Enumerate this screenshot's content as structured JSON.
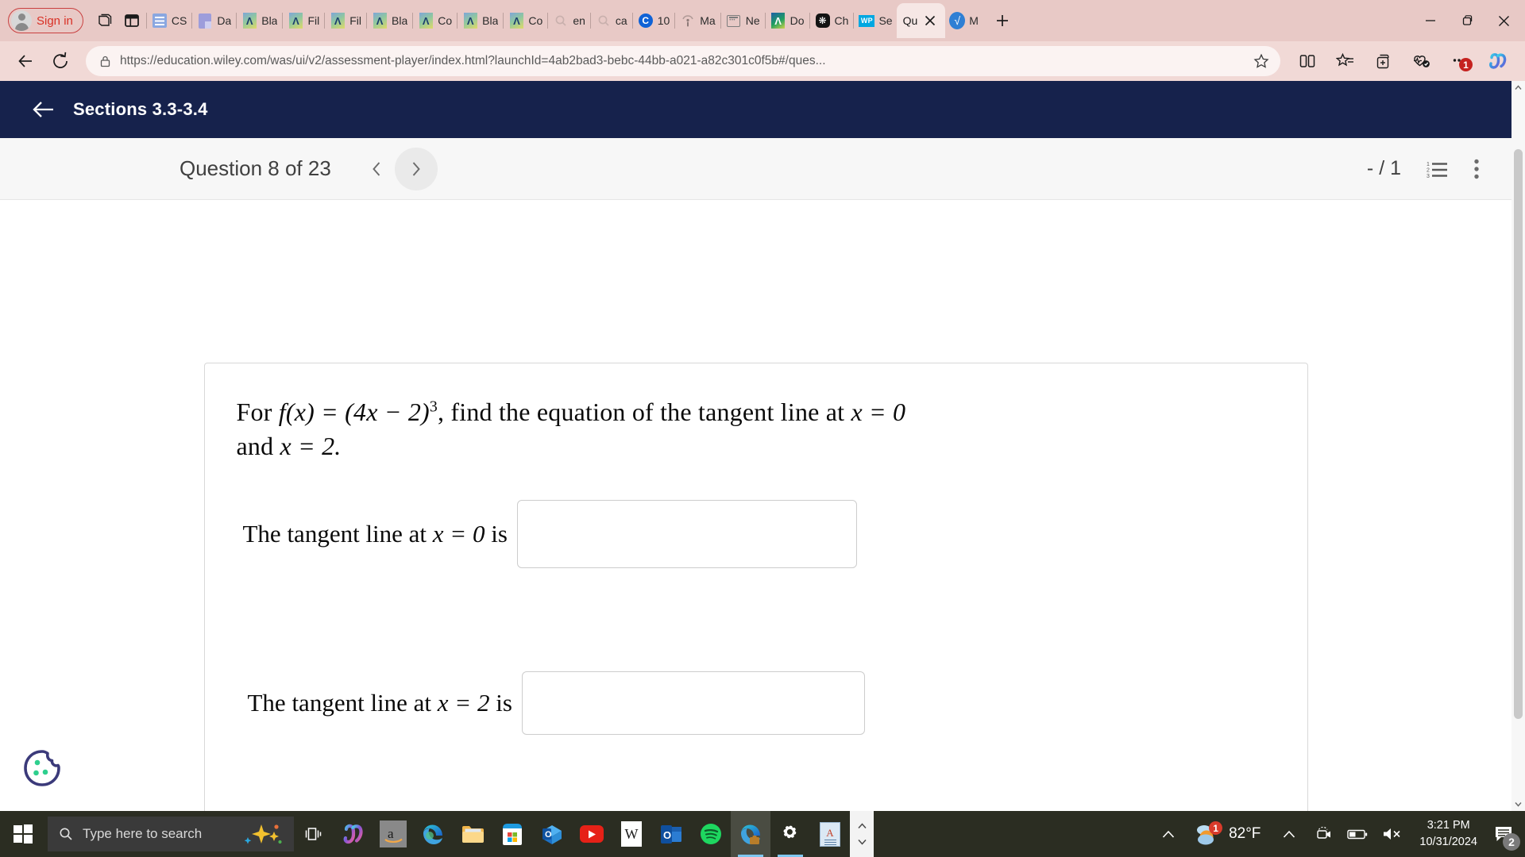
{
  "browser": {
    "signin_label": "Sign in",
    "tabs": [
      {
        "label": "CS",
        "icon": "csv-icon"
      },
      {
        "label": "Da",
        "icon": "document-purple-icon"
      },
      {
        "label": "Bla",
        "icon": "anaconda-icon"
      },
      {
        "label": "Fil",
        "icon": "anaconda-icon"
      },
      {
        "label": "Fil",
        "icon": "anaconda-icon"
      },
      {
        "label": "Bla",
        "icon": "anaconda-icon"
      },
      {
        "label": "Co",
        "icon": "anaconda-icon"
      },
      {
        "label": "Bla",
        "icon": "anaconda-icon"
      },
      {
        "label": "Co",
        "icon": "anaconda-icon"
      },
      {
        "label": "en",
        "icon": "search-icon"
      },
      {
        "label": "ca",
        "icon": "search-icon"
      },
      {
        "label": "10",
        "icon": "circle-c-icon"
      },
      {
        "label": "Ma",
        "icon": "info-icon"
      },
      {
        "label": "Ne",
        "icon": "news-icon"
      },
      {
        "label": "Do",
        "icon": "anaconda-dark-icon"
      },
      {
        "label": "Ch",
        "icon": "openai-icon"
      },
      {
        "label": "Se",
        "icon": "wp-icon"
      }
    ],
    "active_tab": {
      "label": "Qu",
      "icon": "sqrt-icon"
    },
    "trailing_tab": {
      "label": "M",
      "icon": "sqrt-icon"
    },
    "url_display": "https://education.wiley.com/was/ui/v2/assessment-player/index.html?launchId=4ab2bad3-bebc-44bb-a021-a82c301c0f5b#/ques...",
    "url_domain": "education.wiley.com",
    "url_scheme": "https://",
    "url_path": "/was/ui/v2/assessment-player/index.html?launchId=4ab2bad3-bebc-44bb-a021-a82c301c0f5b#/ques...",
    "toolbar_icons": [
      "back-icon",
      "reload-icon",
      "lock-icon",
      "favorite-star-icon",
      "split-screen-icon",
      "favorites-icon",
      "collections-icon",
      "browser-essentials-icon",
      "settings-more-icon",
      "copilot-icon"
    ],
    "settings_badge": "1"
  },
  "app": {
    "header": {
      "title": "Sections 3.3-3.4",
      "back_icon": "back-arrow-icon"
    },
    "question_bar": {
      "title": "Question 8 of 23",
      "prev_icon": "chevron-left-icon",
      "next_icon": "chevron-right-icon",
      "score": "- / 1",
      "list_icon": "numbered-list-icon",
      "menu_icon": "more-vertical-icon"
    },
    "question": {
      "stem_prefix": "For ",
      "stem_fn": "f(x) = (4x − 2)",
      "stem_exp": "3",
      "stem_mid": ", find the equation of the tangent line at ",
      "stem_x0": "x = 0",
      "stem_and": "and ",
      "stem_x2": "x = 2.",
      "answers": [
        {
          "label_pre": "The tangent line at ",
          "label_var": "x = 0",
          "label_post": " is",
          "value": "",
          "placeholder": ""
        },
        {
          "label_pre": "The tangent line at ",
          "label_var": "x = 2",
          "label_post": " is",
          "value": "",
          "placeholder": ""
        }
      ]
    },
    "cookie_icon": "cookie-consent-icon"
  },
  "taskbar": {
    "start_icon": "windows-start-icon",
    "search_placeholder": "Type here to search",
    "search_icon": "search-icon",
    "copilot_sparkle_icon": "sparkle-icon",
    "apps": [
      {
        "name": "task-view-icon"
      },
      {
        "name": "copilot-icon"
      },
      {
        "name": "amazon-icon"
      },
      {
        "name": "edge-icon"
      },
      {
        "name": "file-explorer-icon"
      },
      {
        "name": "microsoft-store-icon"
      },
      {
        "name": "outlook-new-icon"
      },
      {
        "name": "youtube-icon"
      },
      {
        "name": "wikipedia-icon"
      },
      {
        "name": "outlook-icon"
      },
      {
        "name": "spotify-icon"
      },
      {
        "name": "edge-work-icon"
      },
      {
        "name": "settings-gear-icon"
      },
      {
        "name": "document-icon"
      }
    ],
    "tray": {
      "show_hidden_icon": "chevron-up-icon",
      "weather_icon": "weather-rain-icon",
      "weather_badge": "1",
      "temperature": "82°F",
      "camera_icon": "camera-icon",
      "battery_icon": "battery-icon",
      "volume_icon": "volume-muted-icon",
      "time": "3:21 PM",
      "date": "10/31/2024",
      "notification_icon": "notifications-icon",
      "notification_badge": "2"
    }
  },
  "colors": {
    "header_navy": "#16224c",
    "tabstrip": "#e8c9c6",
    "toolbar": "#f1d9d6",
    "accent_red": "#d93025",
    "taskbar": "#2b2d22"
  }
}
